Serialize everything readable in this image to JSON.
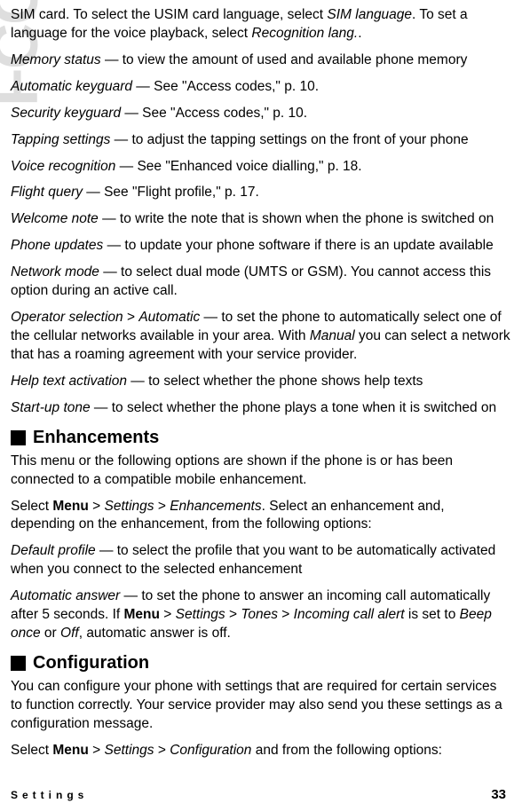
{
  "watermark": "FCC Draft",
  "paragraphs": {
    "p1_a": "SIM card. To select the USIM card language, select ",
    "p1_b": "SIM language",
    "p1_c": ". To set a language for the voice playback, select ",
    "p1_d": "Recognition lang.",
    "p1_e": ".",
    "p2_a": "Memory status",
    "p2_b": " — to view the amount of used and available phone memory",
    "p3_a": "Automatic keyguard",
    "p3_b": " — See \"Access codes,\" p. 10.",
    "p4_a": "Security keyguard",
    "p4_b": " — See \"Access codes,\" p. 10.",
    "p5_a": "Tapping settings",
    "p5_b": " — to adjust the tapping settings on the front of your phone",
    "p6_a": "Voice recognition",
    "p6_b": " — See \"Enhanced voice dialling,\" p. 18.",
    "p7_a": "Flight query",
    "p7_b": " — See \"Flight profile,\" p. 17.",
    "p8_a": "Welcome note",
    "p8_b": " — to write the note that is shown when the phone is switched on",
    "p9_a": "Phone updates",
    "p9_b": " — to update your phone software if there is an update available",
    "p10_a": "Network mode",
    "p10_b": " — to select dual mode (UMTS or GSM). You cannot access this option during an active call.",
    "p11_a": "Operator selection",
    "p11_b": " > ",
    "p11_c": "Automatic",
    "p11_d": " — to set the phone to automatically select one of the cellular networks available in your area. With ",
    "p11_e": "Manual",
    "p11_f": " you can select a network that has a roaming agreement with your service provider.",
    "p12_a": "Help text activation",
    "p12_b": " — to select whether the phone shows help texts",
    "p13_a": "Start-up tone",
    "p13_b": " — to select whether the phone plays a tone when it is switched on"
  },
  "section1": {
    "heading": "Enhancements",
    "p1": "This menu or the following options are shown if the phone is or has been connected to a compatible mobile enhancement.",
    "p2_a": "Select ",
    "p2_b": "Menu",
    "p2_c": " > ",
    "p2_d": "Settings",
    "p2_e": " > ",
    "p2_f": "Enhancements",
    "p2_g": ". Select an enhancement and, depending on the enhancement, from the following options:",
    "p3_a": "Default profile",
    "p3_b": " — to select the profile that you want to be automatically activated when you connect to the selected enhancement",
    "p4_a": "Automatic answer",
    "p4_b": " — to set the phone to answer an incoming call automatically after 5 seconds. If ",
    "p4_c": "Menu",
    "p4_d": " > ",
    "p4_e": "Settings",
    "p4_f": " > ",
    "p4_g": "Tones",
    "p4_h": " > ",
    "p4_i": "Incoming call alert",
    "p4_j": " is set to ",
    "p4_k": "Beep once",
    "p4_l": " or ",
    "p4_m": "Off",
    "p4_n": ", automatic answer is off."
  },
  "section2": {
    "heading": "Configuration",
    "p1": "You can configure your phone with settings that are required for certain services to function correctly. Your service provider may also send you these settings as a configuration message.",
    "p2_a": "Select ",
    "p2_b": "Menu",
    "p2_c": " > ",
    "p2_d": "Settings",
    "p2_e": " > ",
    "p2_f": "Configuration",
    "p2_g": " and from the following options:"
  },
  "footer": {
    "label": "Settings",
    "page": "33"
  }
}
